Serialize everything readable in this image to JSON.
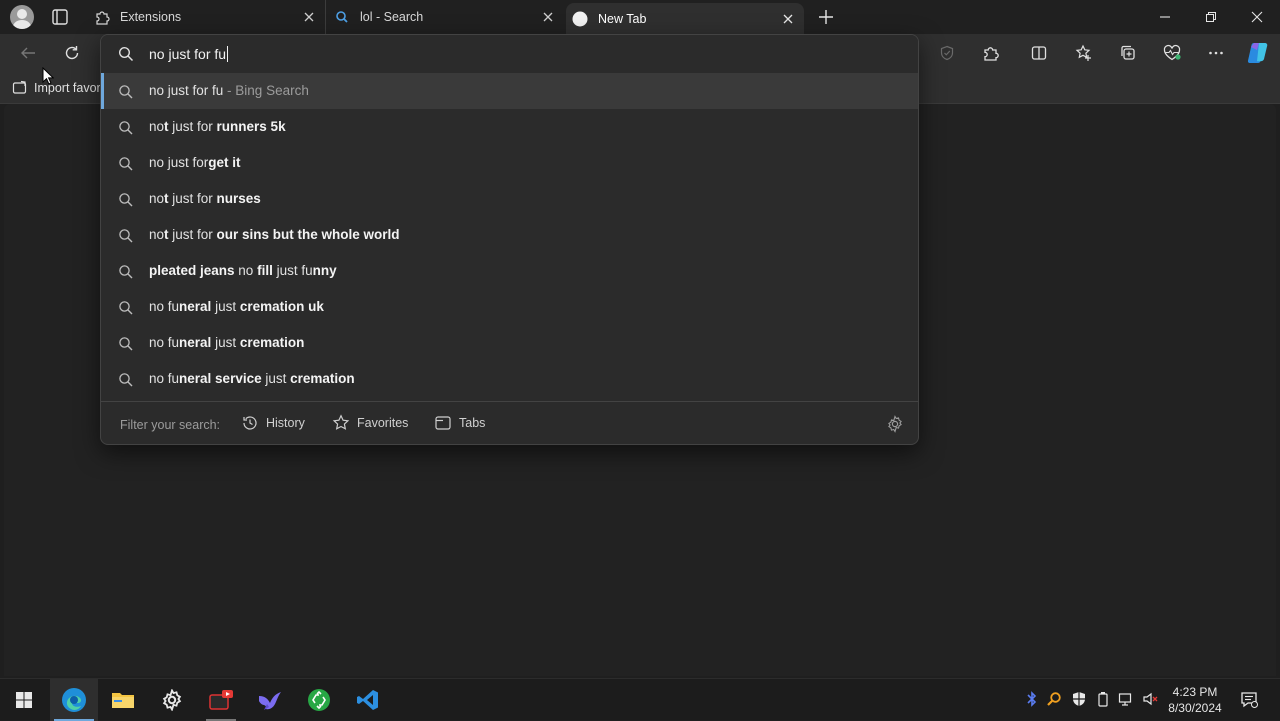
{
  "tabs": [
    {
      "title": "Extensions",
      "icon": "puzzle-icon"
    },
    {
      "title": "lol - Search",
      "icon": "bing-search-icon"
    },
    {
      "title": "New Tab",
      "icon": "new-tab-favicon-icon"
    }
  ],
  "favorites_bar": {
    "import_label": "Import favor"
  },
  "omnibox": {
    "value": "no just for fu",
    "suggestions": [
      {
        "segments": [
          {
            "t": "no just for fu",
            "b": false
          }
        ],
        "suffix": " - Bing Search"
      },
      {
        "segments": [
          {
            "t": "no",
            "b": false
          },
          {
            "t": "t",
            "b": true
          },
          {
            "t": " just for ",
            "b": false
          },
          {
            "t": "runners 5k",
            "b": true
          }
        ],
        "suffix": ""
      },
      {
        "segments": [
          {
            "t": "no just for",
            "b": false
          },
          {
            "t": "get it",
            "b": true
          }
        ],
        "suffix": ""
      },
      {
        "segments": [
          {
            "t": "no",
            "b": false
          },
          {
            "t": "t",
            "b": true
          },
          {
            "t": " just for ",
            "b": false
          },
          {
            "t": "nurses",
            "b": true
          }
        ],
        "suffix": ""
      },
      {
        "segments": [
          {
            "t": "no",
            "b": false
          },
          {
            "t": "t",
            "b": true
          },
          {
            "t": " just for ",
            "b": false
          },
          {
            "t": "our sins but the whole world",
            "b": true
          }
        ],
        "suffix": ""
      },
      {
        "segments": [
          {
            "t": "pleated jeans",
            "b": true
          },
          {
            "t": " no ",
            "b": false
          },
          {
            "t": "fill",
            "b": true
          },
          {
            "t": " just fu",
            "b": false
          },
          {
            "t": "nny",
            "b": true
          }
        ],
        "suffix": ""
      },
      {
        "segments": [
          {
            "t": "no fu",
            "b": false
          },
          {
            "t": "neral",
            "b": true
          },
          {
            "t": " just ",
            "b": false
          },
          {
            "t": "cremation uk",
            "b": true
          }
        ],
        "suffix": ""
      },
      {
        "segments": [
          {
            "t": "no fu",
            "b": false
          },
          {
            "t": "neral",
            "b": true
          },
          {
            "t": " just ",
            "b": false
          },
          {
            "t": "cremation",
            "b": true
          }
        ],
        "suffix": ""
      },
      {
        "segments": [
          {
            "t": "no fu",
            "b": false
          },
          {
            "t": "neral service",
            "b": true
          },
          {
            "t": " just ",
            "b": false
          },
          {
            "t": "cremation",
            "b": true
          }
        ],
        "suffix": ""
      }
    ],
    "filter_label": "Filter your search:",
    "filters": {
      "history": "History",
      "favorites": "Favorites",
      "tabs": "Tabs"
    }
  },
  "taskbar": {
    "apps": [
      "start-icon",
      "edge-icon",
      "file-explorer-icon",
      "settings-icon",
      "video-editor-icon",
      "bird-app-icon",
      "recycle-app-icon",
      "vscode-icon"
    ],
    "time": "4:23 PM",
    "date": "8/30/2024"
  },
  "colors": {
    "accent": "#6fa8dc",
    "edge_blue": "#1f8fd8",
    "vscode_blue": "#2c8fe0"
  }
}
